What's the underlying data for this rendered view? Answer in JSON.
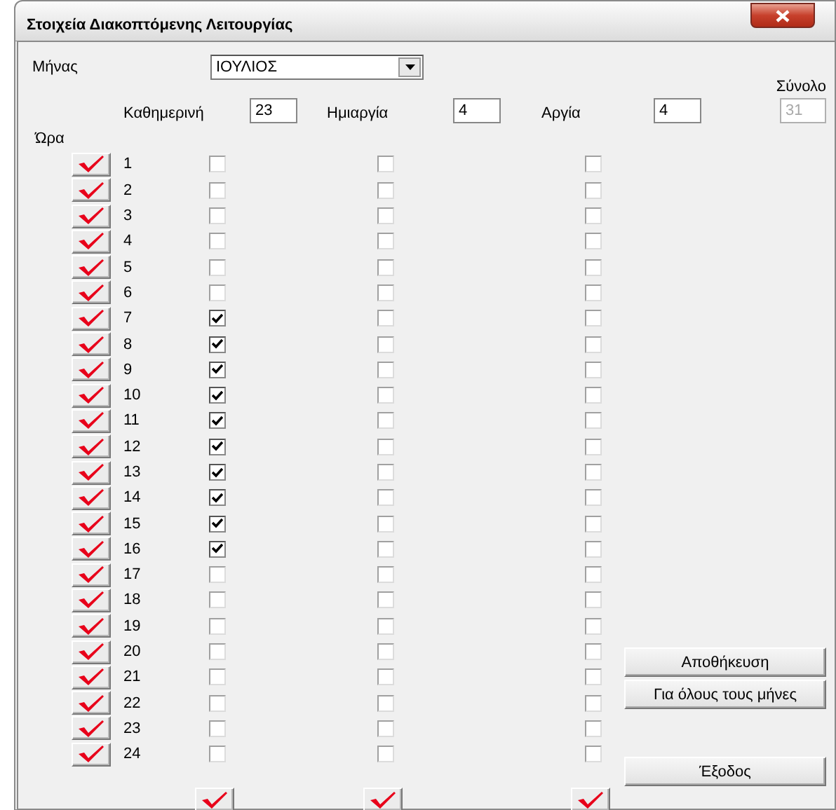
{
  "window": {
    "title": "Στοιχεία Διακοπτόμενης Λειτουργίας"
  },
  "month": {
    "label": "Μήνας",
    "value": "ΙΟΥΛΙΟΣ"
  },
  "counts": [
    {
      "label": "Καθημερινή",
      "value": "23"
    },
    {
      "label": "Ημιαργία",
      "value": "4"
    },
    {
      "label": "Αργία",
      "value": "4"
    }
  ],
  "total": {
    "label": "Σύνολο",
    "value": "31",
    "disabled": true
  },
  "hour_header": "Ώρα",
  "hours": [
    {
      "label": "1",
      "cells": [
        {
          "checked": false
        },
        {
          "checked": false
        },
        {
          "checked": false
        }
      ]
    },
    {
      "label": "2",
      "cells": [
        {
          "checked": false
        },
        {
          "checked": false
        },
        {
          "checked": false
        }
      ]
    },
    {
      "label": "3",
      "cells": [
        {
          "checked": false
        },
        {
          "checked": false
        },
        {
          "checked": false
        }
      ]
    },
    {
      "label": "4",
      "cells": [
        {
          "checked": false
        },
        {
          "checked": false
        },
        {
          "checked": false
        }
      ]
    },
    {
      "label": "5",
      "cells": [
        {
          "checked": false
        },
        {
          "checked": false
        },
        {
          "checked": false
        }
      ]
    },
    {
      "label": "6",
      "cells": [
        {
          "checked": false
        },
        {
          "checked": false
        },
        {
          "checked": false
        }
      ]
    },
    {
      "label": "7",
      "cells": [
        {
          "checked": true
        },
        {
          "checked": false
        },
        {
          "checked": false
        }
      ]
    },
    {
      "label": "8",
      "cells": [
        {
          "checked": true
        },
        {
          "checked": false
        },
        {
          "checked": false
        }
      ]
    },
    {
      "label": "9",
      "cells": [
        {
          "checked": true
        },
        {
          "checked": false
        },
        {
          "checked": false
        }
      ]
    },
    {
      "label": "10",
      "cells": [
        {
          "checked": true
        },
        {
          "checked": false
        },
        {
          "checked": false
        }
      ]
    },
    {
      "label": "11",
      "cells": [
        {
          "checked": true
        },
        {
          "checked": false
        },
        {
          "checked": false
        }
      ]
    },
    {
      "label": "12",
      "cells": [
        {
          "checked": true
        },
        {
          "checked": false
        },
        {
          "checked": false
        }
      ]
    },
    {
      "label": "13",
      "cells": [
        {
          "checked": true
        },
        {
          "checked": false
        },
        {
          "checked": false
        }
      ]
    },
    {
      "label": "14",
      "cells": [
        {
          "checked": true
        },
        {
          "checked": false
        },
        {
          "checked": false
        }
      ]
    },
    {
      "label": "15",
      "cells": [
        {
          "checked": true
        },
        {
          "checked": false
        },
        {
          "checked": false
        }
      ]
    },
    {
      "label": "16",
      "cells": [
        {
          "checked": true
        },
        {
          "checked": false
        },
        {
          "checked": false
        }
      ]
    },
    {
      "label": "17",
      "cells": [
        {
          "checked": false
        },
        {
          "checked": false
        },
        {
          "checked": false
        }
      ]
    },
    {
      "label": "18",
      "cells": [
        {
          "checked": false
        },
        {
          "checked": false
        },
        {
          "checked": false
        }
      ]
    },
    {
      "label": "19",
      "cells": [
        {
          "checked": false
        },
        {
          "checked": false
        },
        {
          "checked": false
        }
      ]
    },
    {
      "label": "20",
      "cells": [
        {
          "checked": false
        },
        {
          "checked": false
        },
        {
          "checked": false
        }
      ]
    },
    {
      "label": "21",
      "cells": [
        {
          "checked": false
        },
        {
          "checked": false
        },
        {
          "checked": false
        }
      ]
    },
    {
      "label": "22",
      "cells": [
        {
          "checked": false
        },
        {
          "checked": false
        },
        {
          "checked": false
        }
      ]
    },
    {
      "label": "23",
      "cells": [
        {
          "checked": false
        },
        {
          "checked": false
        },
        {
          "checked": false
        }
      ]
    },
    {
      "label": "24",
      "cells": [
        {
          "checked": false
        },
        {
          "checked": false
        },
        {
          "checked": false
        }
      ]
    }
  ],
  "buttons": [
    "Αποθήκευση",
    "Για όλους τους μήνες"
  ],
  "exit_button": "Έξοδος"
}
